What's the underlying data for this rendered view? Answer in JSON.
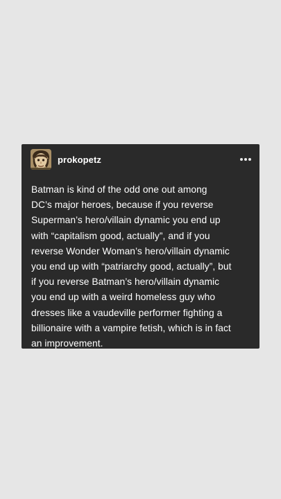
{
  "post": {
    "username": "prokopetz",
    "avatar_icon": "avatar-portrait-icon",
    "more_icon": "more-options-icon",
    "body_lines": [
      "Batman is kind of the odd one out among",
      "DC’s major heroes, because if you reverse",
      "Superman’s hero/villain dynamic you end up",
      "with “capitalism good, actually”, and if you",
      "reverse Wonder Woman’s hero/villain dynamic",
      "you end up with “patriarchy good, actually”, but",
      "if you reverse Batman’s hero/villain dynamic",
      "you end up with a weird homeless guy who",
      "dresses like a vaudeville performer fighting a",
      "billionaire with a vampire fetish, which is in fact",
      "an improvement."
    ]
  },
  "colors": {
    "page_background": "#e6e6e6",
    "card_background": "#2a2a2a",
    "text": "#ffffff"
  }
}
